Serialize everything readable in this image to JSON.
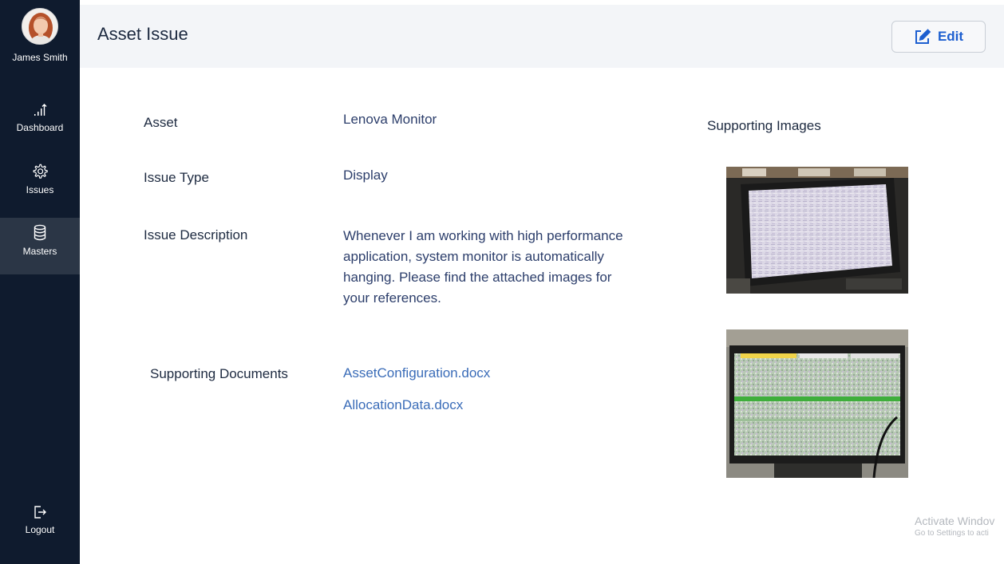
{
  "app": {
    "user_name": "James Smith"
  },
  "sidebar": {
    "items": [
      {
        "label": "Dashboard",
        "icon": "bar-chart-icon"
      },
      {
        "label": "Issues",
        "icon": "gear-icon"
      },
      {
        "label": "Masters",
        "icon": "database-icon",
        "active": true
      }
    ],
    "logout_label": "Logout"
  },
  "header": {
    "title": "Asset Issue",
    "edit_label": "Edit"
  },
  "details": {
    "asset_label": "Asset",
    "asset_value": "Lenova Monitor",
    "issue_type_label": "Issue Type",
    "issue_type_value": "Display",
    "issue_description_label": "Issue Description",
    "issue_description_lines": [
      "Whenever I am working with high performance",
      "application, system monitor is automatically",
      "hanging. Please find the attached images for",
      "your references."
    ],
    "supporting_documents_label": "Supporting Documents",
    "documents": [
      "AssetConfiguration.docx",
      "AllocationData.docx"
    ]
  },
  "images": {
    "title": "Supporting Images"
  },
  "watermark": {
    "line1": "Activate Windov",
    "line2": "Go to Settings to acti"
  },
  "colors": {
    "sidebar_bg": "#0f1b2e",
    "sidebar_active": "#2b3646",
    "header_bg": "#f3f5f8",
    "accent": "#1d5fd0",
    "link": "#3a6cb8"
  }
}
